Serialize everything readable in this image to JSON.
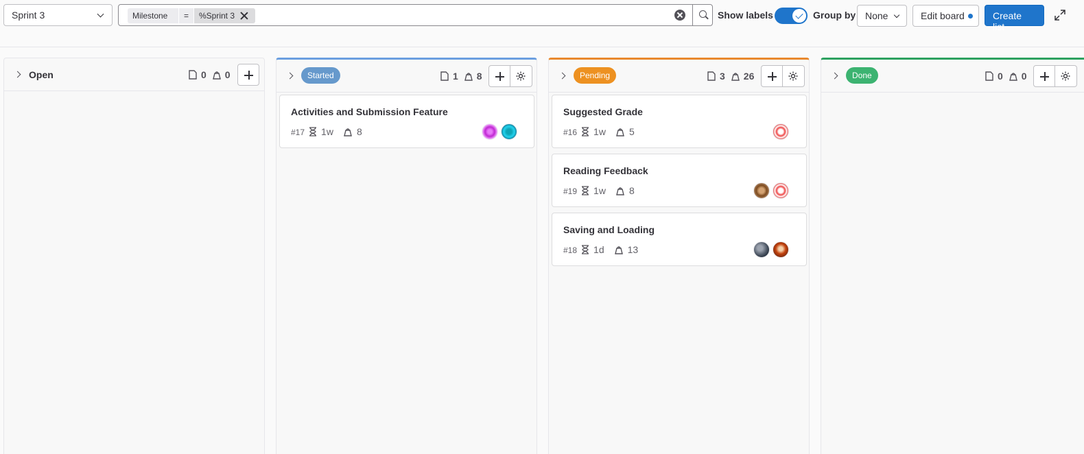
{
  "toolbar": {
    "board_select": "Sprint 3",
    "filter": {
      "token_key": "Milestone",
      "token_operator": "=",
      "token_value": "%Sprint 3"
    },
    "show_labels": "Show labels",
    "show_labels_on": true,
    "group_by": "Group by",
    "group_by_value": "None",
    "edit_board": "Edit board",
    "create_list": "Create list"
  },
  "lists": [
    {
      "title": "Open",
      "label_color": "",
      "issues": "0",
      "weight": "0",
      "cards": []
    },
    {
      "title": "Started",
      "label_color": "#6699cc",
      "issues": "1",
      "weight": "8",
      "cards": [
        {
          "title": "Activities and Submission Feature",
          "ref": "#17",
          "time": "1w",
          "weight": "8",
          "avatars": [
            "pink-pattern-avatar",
            "teal-pattern-avatar"
          ]
        }
      ]
    },
    {
      "title": "Pending",
      "label_color": "#ed9121",
      "issues": "3",
      "weight": "26",
      "cards": [
        {
          "title": "Suggested Grade",
          "ref": "#16",
          "time": "1w",
          "weight": "5",
          "avatars": [
            "red-pattern-avatar"
          ]
        },
        {
          "title": "Reading Feedback",
          "ref": "#19",
          "time": "1w",
          "weight": "8",
          "avatars": [
            "brown-pattern-avatar",
            "red-pattern-avatar"
          ]
        },
        {
          "title": "Saving and Loading",
          "ref": "#18",
          "time": "1d",
          "weight": "13",
          "avatars": [
            "photo-avatar-grey",
            "photo-avatar-dog"
          ]
        }
      ]
    },
    {
      "title": "Done",
      "label_color": "#3cb371",
      "issues": "0",
      "weight": "0",
      "cards": []
    }
  ]
}
